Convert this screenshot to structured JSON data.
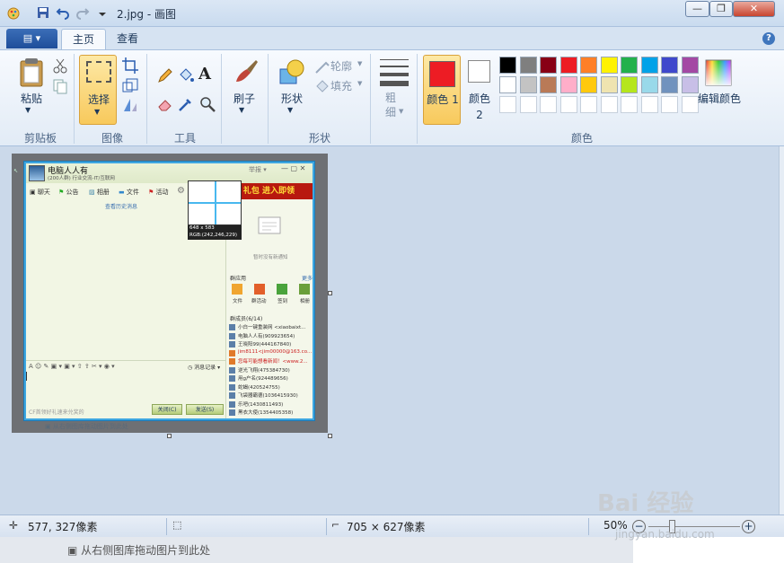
{
  "window": {
    "title": "2.jpg - 画图",
    "minimize": "—",
    "maximize": "❐",
    "close": "✕"
  },
  "tabs": {
    "file": "▤ ▾",
    "home": "主页",
    "view": "查看",
    "help": "?"
  },
  "ribbon": {
    "clipboard": {
      "paste": "粘贴",
      "group": "剪贴板"
    },
    "image": {
      "select": "选择",
      "group": "图像"
    },
    "tools": {
      "group": "工具",
      "text_tool": "A"
    },
    "brushes": {
      "label": "刷子"
    },
    "shapes": {
      "label": "形状",
      "outline": "轮廓",
      "fill": "填充",
      "group": "形状"
    },
    "size": {
      "label": "粗细"
    },
    "colors": {
      "color1": "颜色 1",
      "color2": "颜色 2",
      "edit": "编辑颜色",
      "group": "颜色",
      "color1_value": "#ed1c24",
      "color2_value": "#ffffff",
      "row1": [
        "#000000",
        "#7f7f7f",
        "#880015",
        "#ed1c24",
        "#ff7f27",
        "#fff200",
        "#22b14c",
        "#00a2e8",
        "#3f48cc",
        "#a349a4"
      ],
      "row2": [
        "#ffffff",
        "#c3c3c3",
        "#b97a57",
        "#ffaec9",
        "#ffc90e",
        "#efe4b0",
        "#b5e61d",
        "#99d9ea",
        "#7092be",
        "#c8bfe7"
      ]
    }
  },
  "canvas": {
    "qq": {
      "group_name": "电脑人人有",
      "group_sub": "(200人群) 行业交流-IT/互联网",
      "tabs": [
        "聊天",
        "公告",
        "相册",
        "文件",
        "活动"
      ],
      "history": "查看历史消息",
      "ad": "礼包 进入即领",
      "no_notice": "暂时没有新通知",
      "apps_title": "群应用",
      "apps_more": "更多",
      "apps": [
        "文件",
        "群活动",
        "签到",
        "相册"
      ],
      "members_title": "群成员(6/14)",
      "members": [
        "小白一键重装网 <xiaobaixt...",
        "电脑人人有(909923654)",
        "王晓阳99(444167840)",
        "jim8111<jim00000@163.co...",
        "您每可能想看新闻！<www.2...",
        "逆光飞翔(475384730)",
        "用g户名(924489656)",
        "蛇蝎(420524755)",
        "飞袋器霸德(1036415930)",
        "乐吧(1430811493)",
        "黑衣大使(1354405358)"
      ],
      "msg_record": "消息记录",
      "close_btn": "关闭(C)",
      "send_btn": "发送(S)",
      "footer": "CF首领好礼速来兑奖的",
      "titlebar_ctrl": "举报 ▾"
    },
    "magnifier": {
      "size": "648 x 583",
      "rgb": "RGB:(242,246,229)"
    },
    "ghost_text": "从右侧图库拖动图片到此处"
  },
  "status": {
    "cursor_pos": "577, 327像素",
    "image_size": "705 × 627像素",
    "zoom": "50%",
    "zoom_out": "−",
    "zoom_in": "+"
  },
  "watermark": {
    "brand": "Bai 经验",
    "url": "jingyan.baidu.com"
  }
}
